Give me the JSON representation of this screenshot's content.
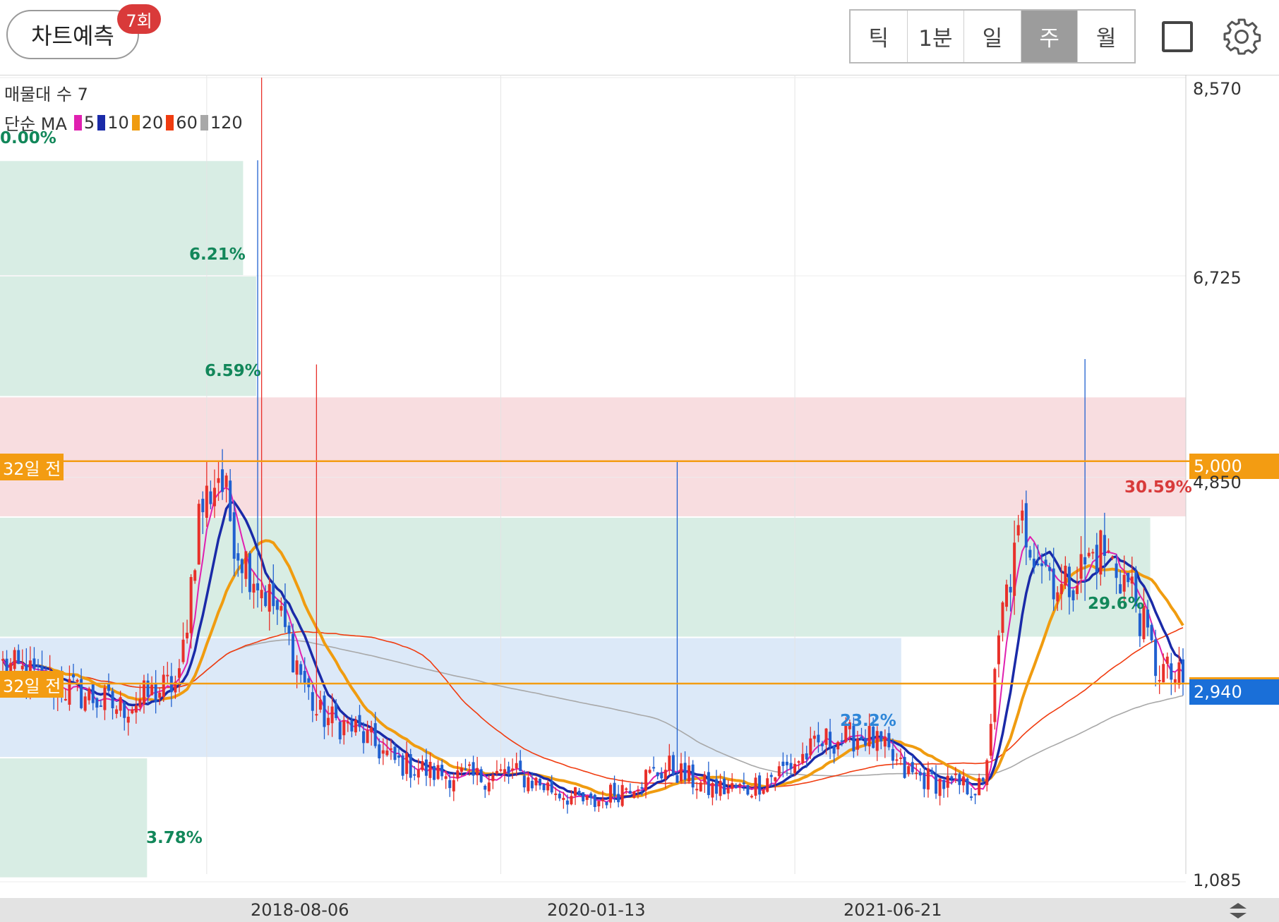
{
  "toolbar": {
    "predict_label": "차트예측",
    "predict_count": "7회",
    "periods": [
      "틱",
      "1분",
      "일",
      "주",
      "월"
    ],
    "active_period": "주"
  },
  "legend": {
    "volume_profile": "매물대 수 7",
    "ma_title": "단순 MA",
    "ma_items": [
      {
        "label": "5",
        "color": "#e020b0"
      },
      {
        "label": "10",
        "color": "#1a2aa8"
      },
      {
        "label": "20",
        "color": "#f09c10"
      },
      {
        "label": "60",
        "color": "#f03c10"
      },
      {
        "label": "120",
        "color": "#a8a8a8"
      }
    ]
  },
  "colors": {
    "up": "#e8302a",
    "down": "#2060d0",
    "zone_green": "#d8ede4",
    "zone_red": "#f8dde0",
    "zone_blue": "#dce9f8",
    "accent_orange": "#f39c12",
    "current_blue": "#1a6fd8",
    "pct_green": "#12875a",
    "pct_red": "#d83a3a"
  },
  "chart_data": {
    "type": "candlestick",
    "interval": "weekly",
    "ylim": [
      1085,
      8570
    ],
    "y_ticks": [
      "8,570",
      "6,725",
      "4,850",
      "1,085"
    ],
    "x_ticks": [
      {
        "label": "2018-08-06",
        "index": 52
      },
      {
        "label": "2020-01-13",
        "index": 127
      },
      {
        "label": "2021-06-21",
        "index": 202
      }
    ],
    "candle_count": 302,
    "ohlc_anchors": [
      [
        0,
        3100
      ],
      [
        15,
        2900
      ],
      [
        30,
        2700
      ],
      [
        45,
        2950
      ],
      [
        50,
        4500
      ],
      [
        55,
        4900
      ],
      [
        60,
        4200
      ],
      [
        70,
        3600
      ],
      [
        80,
        2650
      ],
      [
        90,
        2500
      ],
      [
        100,
        2200
      ],
      [
        110,
        2100
      ],
      [
        120,
        2050
      ],
      [
        130,
        2100
      ],
      [
        140,
        1950
      ],
      [
        150,
        1800
      ],
      [
        160,
        2000
      ],
      [
        170,
        2150
      ],
      [
        180,
        1950
      ],
      [
        190,
        1950
      ],
      [
        200,
        2150
      ],
      [
        210,
        2400
      ],
      [
        220,
        2450
      ],
      [
        225,
        2300
      ],
      [
        230,
        2100
      ],
      [
        240,
        2000
      ],
      [
        250,
        1950
      ],
      [
        255,
        3600
      ],
      [
        260,
        4400
      ],
      [
        270,
        3800
      ],
      [
        280,
        4200
      ],
      [
        288,
        3800
      ],
      [
        294,
        3100
      ],
      [
        298,
        3000
      ],
      [
        301,
        2940
      ]
    ],
    "spikes": [
      {
        "index": 66,
        "high": 8570,
        "low": 3600
      },
      {
        "index": 65,
        "high": 7800,
        "low": 4300
      },
      {
        "index": 80,
        "high": 5900,
        "low": 3200
      },
      {
        "index": 172,
        "high": 5000,
        "low": 2300
      },
      {
        "index": 276,
        "high": 5950,
        "low": 3700
      }
    ],
    "volume_profile": [
      {
        "from": 7800,
        "to": 6725,
        "percent": "6.21%",
        "zone": "green",
        "length": 0.205
      },
      {
        "from": 6725,
        "to": 5600,
        "percent": "6.59%",
        "zone": "green",
        "length": 0.216
      },
      {
        "from": 5600,
        "to": 4480,
        "percent": "30.59%",
        "zone": "red",
        "length": 1.0
      },
      {
        "from": 4480,
        "to": 3360,
        "percent": "29.6%",
        "zone": "green",
        "length": 0.97
      },
      {
        "from": 3360,
        "to": 2240,
        "percent": "23.2%",
        "zone": "blue",
        "length": 0.76
      },
      {
        "from": 2240,
        "to": 1120,
        "percent": "3.78%",
        "zone": "green",
        "length": 0.124
      }
    ],
    "top_percent": "0.00%",
    "lines": [
      {
        "label": "32일 전",
        "value": 5000,
        "price_label": "5,000"
      },
      {
        "label": "32일 전",
        "value": 2930,
        "price_label": ""
      }
    ],
    "current_price": {
      "value": 2940,
      "label": "2,940"
    }
  }
}
